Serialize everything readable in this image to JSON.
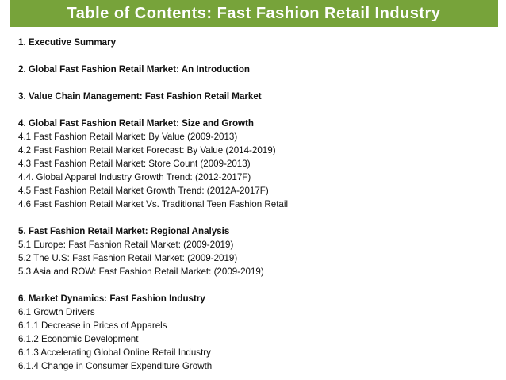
{
  "header": {
    "title": "Table of Contents: Fast Fashion Retail Industry",
    "background_color": "#77a33a",
    "text_color": "#ffffff"
  },
  "sections": [
    {
      "heading": "1. Executive Summary",
      "items": []
    },
    {
      "heading": "2. Global Fast Fashion Retail Market: An Introduction",
      "items": []
    },
    {
      "heading": "3. Value Chain Management: Fast Fashion Retail Market",
      "items": []
    },
    {
      "heading": "4. Global Fast Fashion Retail Market: Size and Growth",
      "items": [
        "4.1 Fast Fashion Retail Market: By Value (2009-2013)",
        "4.2 Fast Fashion Retail Market Forecast: By Value (2014-2019)",
        "4.3 Fast Fashion Retail Market: Store Count (2009-2013)",
        "4.4. Global Apparel Industry Growth Trend: (2012-2017F)",
        "4.5 Fast Fashion Retail Market Growth Trend: (2012A-2017F)",
        "4.6 Fast Fashion Retail Market Vs. Traditional Teen Fashion Retail"
      ]
    },
    {
      "heading": "5. Fast Fashion Retail Market: Regional Analysis",
      "items": [
        "5.1 Europe: Fast Fashion Retail Market: (2009-2019)",
        "5.2 The U.S: Fast Fashion Retail Market: (2009-2019)",
        "5.3 Asia and ROW: Fast Fashion Retail Market: (2009-2019)"
      ]
    },
    {
      "heading": "6. Market Dynamics: Fast Fashion Industry",
      "items": [
        "6.1 Growth Drivers",
        "6.1.1 Decrease in Prices of Apparels",
        "6.1.2 Economic Development",
        "6.1.3 Accelerating Global Online Retail Industry",
        "6.1.4 Change in Consumer Expenditure Growth"
      ]
    }
  ]
}
